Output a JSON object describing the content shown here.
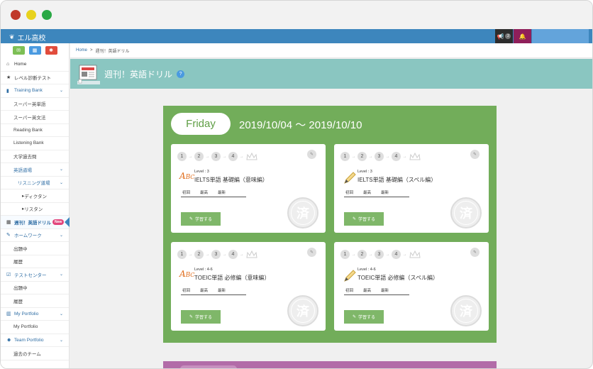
{
  "app": {
    "name": "エル高校"
  },
  "topbar": {
    "notice_count": "2"
  },
  "sidebar": {
    "items": [
      {
        "label": "Home",
        "icon": "home-icon"
      },
      {
        "label": "レベル診断テスト",
        "icon": "star-icon"
      },
      {
        "label": "Training Bank",
        "icon": "book-icon"
      },
      {
        "label": "スーパー英単語"
      },
      {
        "label": "スーパー英文法"
      },
      {
        "label": "Reading Bank"
      },
      {
        "label": "Listening Bank"
      },
      {
        "label": "大学過去問"
      },
      {
        "label": "英語道場"
      },
      {
        "label": "リスニング道場"
      },
      {
        "label": "ディクタン"
      },
      {
        "label": "リスタン"
      },
      {
        "label": "週刊！英語ドリル",
        "badge": "New"
      },
      {
        "label": "ホームワーク",
        "icon": "pencil-icon"
      },
      {
        "label": "出題中"
      },
      {
        "label": "履歴"
      },
      {
        "label": "テストセンター",
        "icon": "checkbox-icon"
      },
      {
        "label": "出題中"
      },
      {
        "label": "履歴"
      },
      {
        "label": "My Portfolio",
        "icon": "chart-icon"
      },
      {
        "label": "My Portfolio"
      },
      {
        "label": "Team Portfolio",
        "icon": "users-icon"
      },
      {
        "label": "過去のチーム"
      }
    ]
  },
  "breadcrumb": {
    "home": "Home",
    "separator": ">",
    "current": "週刊！英語ドリル"
  },
  "header": {
    "title": "週刊！英語ドリル",
    "help": "?"
  },
  "week": {
    "day": "Friday",
    "range": "2019/10/04 〜 2019/10/10",
    "steps": [
      "1",
      "2",
      "3",
      "4"
    ],
    "cards": [
      {
        "level": "Level : 3",
        "title": "IELTS単語 基礎編（意味編）",
        "icon": "abc-icon",
        "scores": [
          "初回",
          "最高",
          "最新"
        ],
        "button": "学習する",
        "seal": "済"
      },
      {
        "level": "Level : 3",
        "title": "IELTS単語 基礎編（スペル編）",
        "icon": "pencil-icon",
        "scores": [
          "初回",
          "最高",
          "最新"
        ],
        "button": "学習する",
        "seal": "済"
      },
      {
        "level": "Level : 4-6",
        "title": "TOEIC単語 必修編（意味編）",
        "icon": "abc-icon",
        "scores": [
          "初回",
          "最高",
          "最新"
        ],
        "button": "学習する",
        "seal": "済"
      },
      {
        "level": "Level : 4-6",
        "title": "TOEIC単語 必修編（スペル編）",
        "icon": "pencil-icon",
        "scores": [
          "初回",
          "最高",
          "最新"
        ],
        "button": "学習する",
        "seal": "済"
      }
    ]
  },
  "colors": {
    "topbar": "#3d86bd",
    "header": "#8ac6c1",
    "panel": "#72ad5a",
    "next_panel": "#b26ca8"
  }
}
